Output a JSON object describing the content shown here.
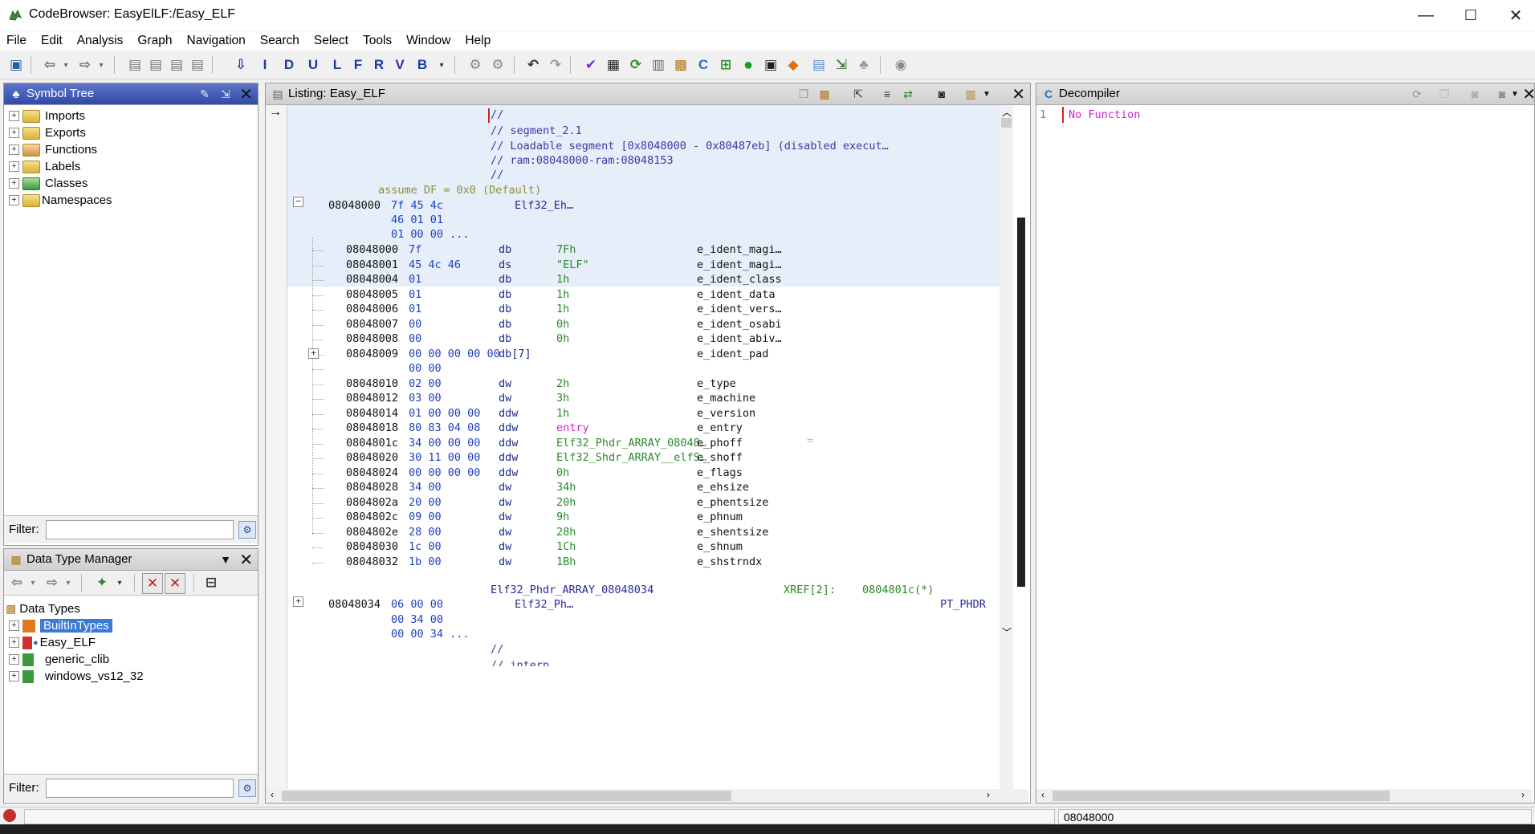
{
  "window": {
    "title": "CodeBrowser: EasyElLF:/Easy_ELF",
    "minimize": "—",
    "maximize": "☐",
    "close": "✕"
  },
  "menu": [
    "File",
    "Edit",
    "Analysis",
    "Graph",
    "Navigation",
    "Search",
    "Select",
    "Tools",
    "Window",
    "Help"
  ],
  "symbol_tree": {
    "title": "Symbol Tree",
    "items": [
      "Imports",
      "Exports",
      "Functions",
      "Labels",
      "Classes",
      "Namespaces"
    ],
    "filter_label": "Filter:"
  },
  "data_type_manager": {
    "title": "Data Type Manager",
    "root": "Data Types",
    "items": [
      "BuiltInTypes",
      "Easy_ELF",
      "generic_clib",
      "windows_vs12_32"
    ],
    "filter_label": "Filter:"
  },
  "listing": {
    "title": "Listing:  Easy_ELF",
    "header_comments": [
      "//",
      "// segment_2.1",
      "// Loadable segment  [0x8048000 - 0x80487eb] (disabled execut…",
      "// ram:08048000-ram:08048153",
      "//"
    ],
    "assume": "assume DF = 0x0  (Default)",
    "struct_head": {
      "addr": "08048000",
      "bytes": "7f 45 4c",
      "bytes2": "46 01 01",
      "bytes3": "01 00 00 ...",
      "label": "Elf32_Eh…"
    },
    "rows": [
      {
        "addr": "08048000",
        "bytes": "7f",
        "mnem": "db",
        "op": "7Fh",
        "field": "e_ident_magi…"
      },
      {
        "addr": "08048001",
        "bytes": "45 4c 46",
        "mnem": "ds",
        "op": "\"ELF\"",
        "field": "e_ident_magi…"
      },
      {
        "addr": "08048004",
        "bytes": "01",
        "mnem": "db",
        "op": "1h",
        "field": "e_ident_class"
      },
      {
        "addr": "08048005",
        "bytes": "01",
        "mnem": "db",
        "op": "1h",
        "field": "e_ident_data"
      },
      {
        "addr": "08048006",
        "bytes": "01",
        "mnem": "db",
        "op": "1h",
        "field": "e_ident_vers…"
      },
      {
        "addr": "08048007",
        "bytes": "00",
        "mnem": "db",
        "op": "0h",
        "field": "e_ident_osabi"
      },
      {
        "addr": "08048008",
        "bytes": "00",
        "mnem": "db",
        "op": "0h",
        "field": "e_ident_abiv…"
      },
      {
        "addr": "08048009",
        "bytes": "00 00 00 00 00",
        "mnem": "db[7]",
        "op": "",
        "field": "e_ident_pad"
      },
      {
        "addr": "",
        "bytes": "00 00",
        "mnem": "",
        "op": "",
        "field": ""
      },
      {
        "addr": "08048010",
        "bytes": "02 00",
        "mnem": "dw",
        "op": "2h",
        "field": "e_type"
      },
      {
        "addr": "08048012",
        "bytes": "03 00",
        "mnem": "dw",
        "op": "3h",
        "field": "e_machine"
      },
      {
        "addr": "08048014",
        "bytes": "01 00 00 00",
        "mnem": "ddw",
        "op": "1h",
        "field": "e_version"
      },
      {
        "addr": "08048018",
        "bytes": "80 83 04 08",
        "mnem": "ddw",
        "op": "entry",
        "field": "e_entry"
      },
      {
        "addr": "0804801c",
        "bytes": "34 00 00 00",
        "mnem": "ddw",
        "op": "Elf32_Phdr_ARRAY_08048…",
        "field": "e_phoff"
      },
      {
        "addr": "08048020",
        "bytes": "30 11 00 00",
        "mnem": "ddw",
        "op": "Elf32_Shdr_ARRAY__elfS…",
        "field": "e_shoff"
      },
      {
        "addr": "08048024",
        "bytes": "00 00 00 00",
        "mnem": "ddw",
        "op": "0h",
        "field": "e_flags"
      },
      {
        "addr": "08048028",
        "bytes": "34 00",
        "mnem": "dw",
        "op": "34h",
        "field": "e_ehsize"
      },
      {
        "addr": "0804802a",
        "bytes": "20 00",
        "mnem": "dw",
        "op": "20h",
        "field": "e_phentsize"
      },
      {
        "addr": "0804802c",
        "bytes": "09 00",
        "mnem": "dw",
        "op": "9h",
        "field": "e_phnum"
      },
      {
        "addr": "0804802e",
        "bytes": "28 00",
        "mnem": "dw",
        "op": "28h",
        "field": "e_shentsize"
      },
      {
        "addr": "08048030",
        "bytes": "1c 00",
        "mnem": "dw",
        "op": "1Ch",
        "field": "e_shnum"
      },
      {
        "addr": "08048032",
        "bytes": "1b 00",
        "mnem": "dw",
        "op": "1Bh",
        "field": "e_shstrndx"
      }
    ],
    "phdr_label": "Elf32_Phdr_ARRAY_08048034",
    "xref": "XREF[2]:",
    "xref_target": "0804801c(*)",
    "phdr_head": {
      "addr": "08048034",
      "bytes": "06 00 00",
      "bytes2": "00 34 00",
      "bytes3": "00 00 34 ...",
      "label": "Elf32_Ph…",
      "type": "PT_PHDR"
    },
    "tail_comments": [
      "//",
      "// interp"
    ],
    "eq_marker": "="
  },
  "decompiler": {
    "title": "Decompiler",
    "line_no": "1",
    "text": "No Function"
  },
  "status": {
    "address": "08048000"
  },
  "colors": {
    "accent": "#2f4aa8",
    "decompiler_text": "#d020d0",
    "operand_green": "#2a8a2a",
    "bytes_blue": "#2040c0"
  }
}
